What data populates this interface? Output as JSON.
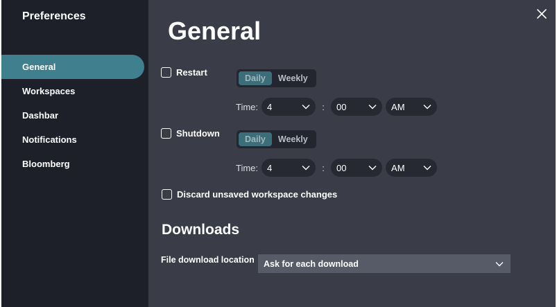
{
  "sidebar": {
    "title": "Preferences",
    "items": [
      {
        "label": "General"
      },
      {
        "label": "Workspaces"
      },
      {
        "label": "Dashbar"
      },
      {
        "label": "Notifications"
      },
      {
        "label": "Bloomberg"
      }
    ],
    "active_item": "General"
  },
  "main": {
    "title": "General",
    "restart": {
      "label": "Restart",
      "checked": false,
      "frequency": {
        "options": [
          "Daily",
          "Weekly"
        ],
        "selected": "Daily"
      },
      "time_label": "Time:",
      "hour": "4",
      "colon": ":",
      "minute": "00",
      "ampm": "AM"
    },
    "shutdown": {
      "label": "Shutdown",
      "checked": false,
      "frequency": {
        "options": [
          "Daily",
          "Weekly"
        ],
        "selected": "Daily"
      },
      "time_label": "Time:",
      "hour": "4",
      "colon": ":",
      "minute": "00",
      "ampm": "AM"
    },
    "discard": {
      "label": "Discard unsaved workspace changes",
      "checked": false
    },
    "downloads": {
      "title": "Downloads",
      "location_label": "File download location",
      "location_value": "Ask for each download"
    }
  },
  "colors": {
    "sidebar_bg": "#1d2029",
    "content_bg": "#3a3d48",
    "accent": "#3f7f8e",
    "segment_active": "#3c6e7a",
    "select_bg": "#262932",
    "download_select_bg": "#565b67"
  },
  "icons": {
    "close": "close-icon",
    "chevron": "chevron-down-icon"
  }
}
